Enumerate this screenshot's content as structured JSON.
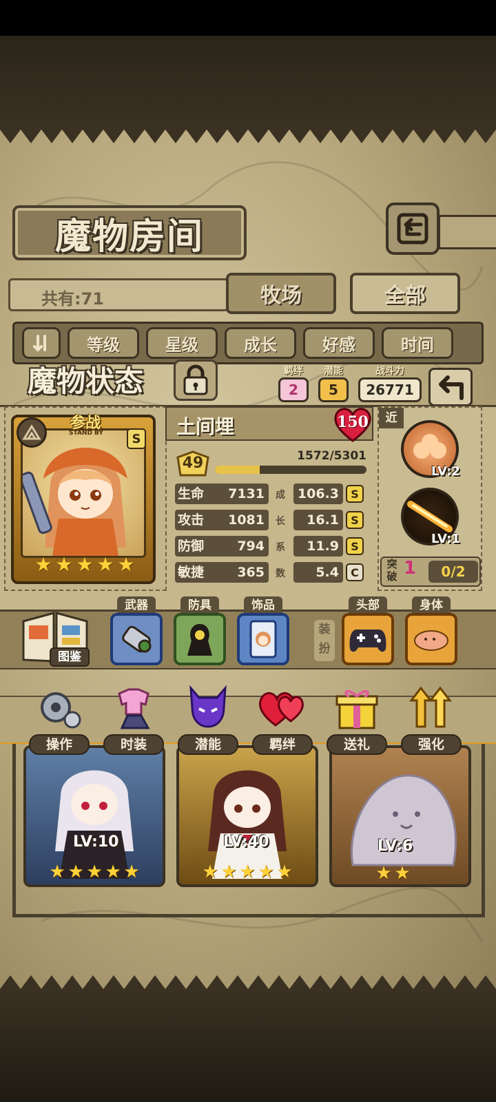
{
  "header": {
    "title": "魔物房间"
  },
  "summary": {
    "count_text": "共有:71"
  },
  "tabs": {
    "farm": "牧场",
    "all": "全部"
  },
  "filters": [
    "等级",
    "星级",
    "成长",
    "好感",
    "时间"
  ],
  "status": {
    "title": "魔物状态",
    "bond_label": "羁绊",
    "bond_value": "2",
    "potential_label": "潜能",
    "potential_value": "5",
    "power_label": "战斗力",
    "power_value": "26771"
  },
  "card": {
    "standby_label": "参战",
    "standby_sub": "STAND BY",
    "rank": "S",
    "stars": 5
  },
  "monster": {
    "name": "土间埋",
    "max_level": "150",
    "level": "49",
    "exp_text": "1572/5301",
    "exp_fraction": 0.297
  },
  "stats": [
    {
      "name": "生命",
      "value": "7131",
      "growth": "106.3",
      "grade": "S"
    },
    {
      "name": "攻击",
      "value": "1081",
      "growth": "16.1",
      "grade": "S"
    },
    {
      "name": "防御",
      "value": "794",
      "growth": "11.9",
      "grade": "S"
    },
    {
      "name": "敏捷",
      "value": "365",
      "growth": "5.4",
      "grade": "C"
    }
  ],
  "growth_chars": [
    "成",
    "长",
    "系",
    "数"
  ],
  "side": {
    "melee_tag": "近",
    "skills": [
      {
        "level": "LV:2"
      },
      {
        "level": "LV:1"
      }
    ],
    "break_label": "突破",
    "break_count": "1",
    "break_progress": "0/2"
  },
  "equipment": {
    "dex_label": "图鉴",
    "weapon_tag": "武器",
    "armor_tag": "防具",
    "accessory_tag": "饰品",
    "outfit_label": "装扮",
    "head_tag": "头部",
    "body_tag": "身体"
  },
  "actions": [
    "操作",
    "时装",
    "潜能",
    "羁绊",
    "送礼",
    "强化"
  ],
  "grid_cards": [
    {
      "level": "LV:10",
      "stars": 5
    },
    {
      "level": "LV:40",
      "stars": 5
    },
    {
      "level": "LV:6",
      "stars": 2
    }
  ],
  "colors": {
    "gold": "#f0d24a",
    "panel": "#c6b78d",
    "dark": "#4a3f2c",
    "bond": "#f4c6d8"
  }
}
